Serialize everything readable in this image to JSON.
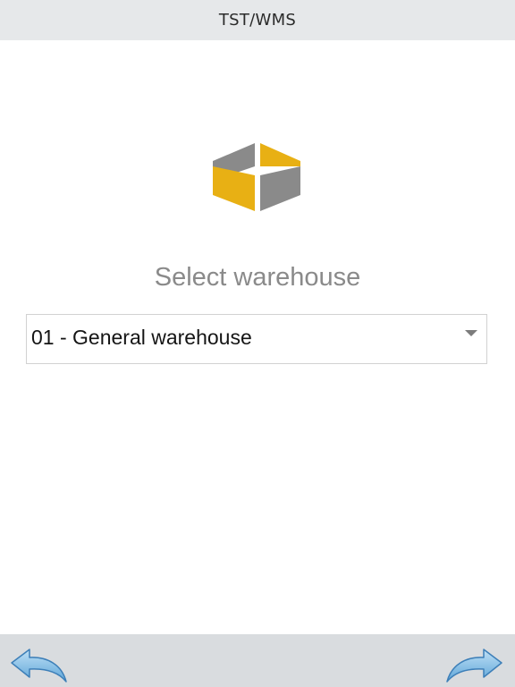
{
  "header": {
    "title": "TST/WMS"
  },
  "logo": {
    "icon": "warehouse-box-icon",
    "colors": {
      "yellow": "#e8b014",
      "gray": "#8a8a8a"
    }
  },
  "main": {
    "prompt": "Select warehouse",
    "warehouse_select": {
      "selected": "01 - General warehouse"
    }
  },
  "footer": {
    "back_icon": "back-arrow-icon",
    "forward_icon": "forward-arrow-icon"
  }
}
